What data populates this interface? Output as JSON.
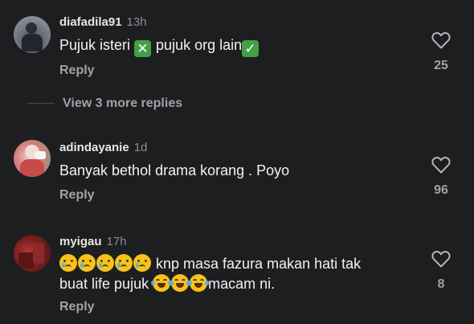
{
  "comments": [
    {
      "username": "diafadila91",
      "time": "13h",
      "text_a": "Pujuk isteri ",
      "text_b": " pujuk org lain",
      "reply_label": "Reply",
      "like_count": "25"
    },
    {
      "username": "adindayanie",
      "time": "1d",
      "text": "Banyak bethol drama korang . Poyo",
      "reply_label": "Reply",
      "like_count": "96"
    },
    {
      "username": "myigau",
      "time": "17h",
      "line1_text": " knp masa fazura makan hati tak",
      "line2_text": "buat life pujuk ",
      "line2_tail": "macam ni.",
      "reply_label": "Reply",
      "like_count": "8"
    }
  ],
  "view_more": "View 3 more replies",
  "icons": {
    "like": "heart-outline-icon",
    "cross": "cross-mark-button-emoji",
    "check": "check-mark-button-emoji",
    "cry": "crying-face-emoji",
    "laugh": "tears-of-joy-emoji"
  },
  "colors": {
    "background": "#1d1e20",
    "secondary_text": "#a2a2a7",
    "emoji_green": "#43a047"
  }
}
